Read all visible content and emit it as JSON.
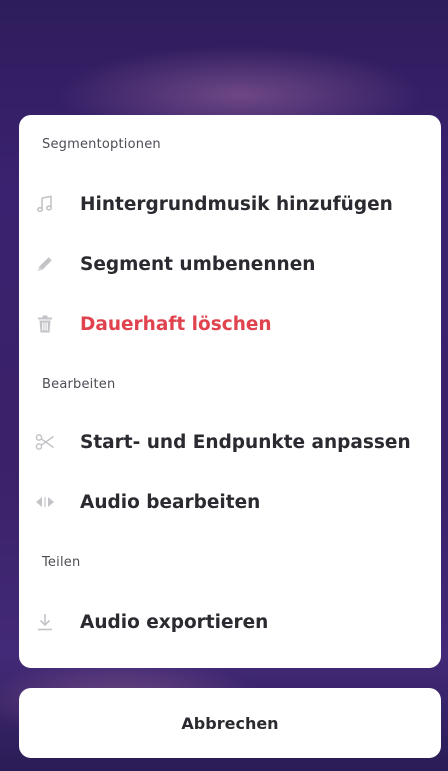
{
  "sections": [
    {
      "title": "Segmentoptionen",
      "items": [
        {
          "label": "Hintergrundmusik hinzufügen",
          "icon": "music-note-icon"
        },
        {
          "label": "Segment umbenennen",
          "icon": "pencil-icon"
        },
        {
          "label": "Dauerhaft löschen",
          "icon": "trash-icon",
          "color": "#e0424e"
        }
      ]
    },
    {
      "title": "Bearbeiten",
      "items": [
        {
          "label": "Start- und Endpunkte anpassen",
          "icon": "scissors-icon"
        },
        {
          "label": "Audio bearbeiten",
          "icon": "audio-edit-arrows-icon"
        }
      ]
    },
    {
      "title": "Teilen",
      "items": [
        {
          "label": "Audio exportieren",
          "icon": "download-icon"
        }
      ]
    }
  ],
  "cancel_label": "Abbrechen",
  "colors": {
    "danger": "#e0424e",
    "text": "#2a2a30",
    "icon": "#c4c4c8",
    "background": "#3a2168"
  }
}
